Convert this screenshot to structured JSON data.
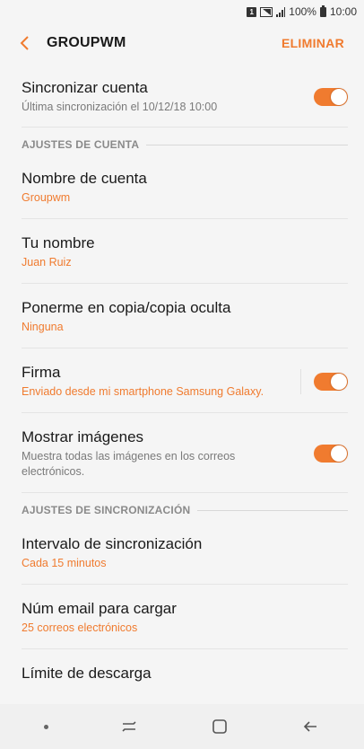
{
  "status": {
    "sim": "1",
    "battery": "100%",
    "time": "10:00"
  },
  "appbar": {
    "title": "GROUPWM",
    "action": "ELIMINAR"
  },
  "sync": {
    "title": "Sincronizar cuenta",
    "subtitle": "Última sincronización el 10/12/18  10:00",
    "enabled": true
  },
  "sections": {
    "account": "AJUSTES DE CUENTA",
    "sync": "AJUSTES DE SINCRONIZACIÓN"
  },
  "account": {
    "name": {
      "title": "Nombre de cuenta",
      "value": "Groupwm"
    },
    "your_name": {
      "title": "Tu nombre",
      "value": "Juan Ruiz"
    },
    "cc_bcc": {
      "title": "Ponerme en copia/copia oculta",
      "value": "Ninguna"
    },
    "signature": {
      "title": "Firma",
      "value": "Enviado desde mi smartphone Samsung Galaxy.",
      "enabled": true
    },
    "images": {
      "title": "Mostrar imágenes",
      "subtitle": "Muestra todas las imágenes en los correos electrónicos.",
      "enabled": true
    }
  },
  "sync_settings": {
    "interval": {
      "title": "Intervalo de sincronización",
      "value": "Cada 15 minutos"
    },
    "emails": {
      "title": "Núm email para cargar",
      "value": "25 correos electrónicos"
    },
    "limit": {
      "title": "Límite de descarga"
    }
  },
  "colors": {
    "accent": "#f07b2f",
    "background": "#f5f5f5"
  }
}
